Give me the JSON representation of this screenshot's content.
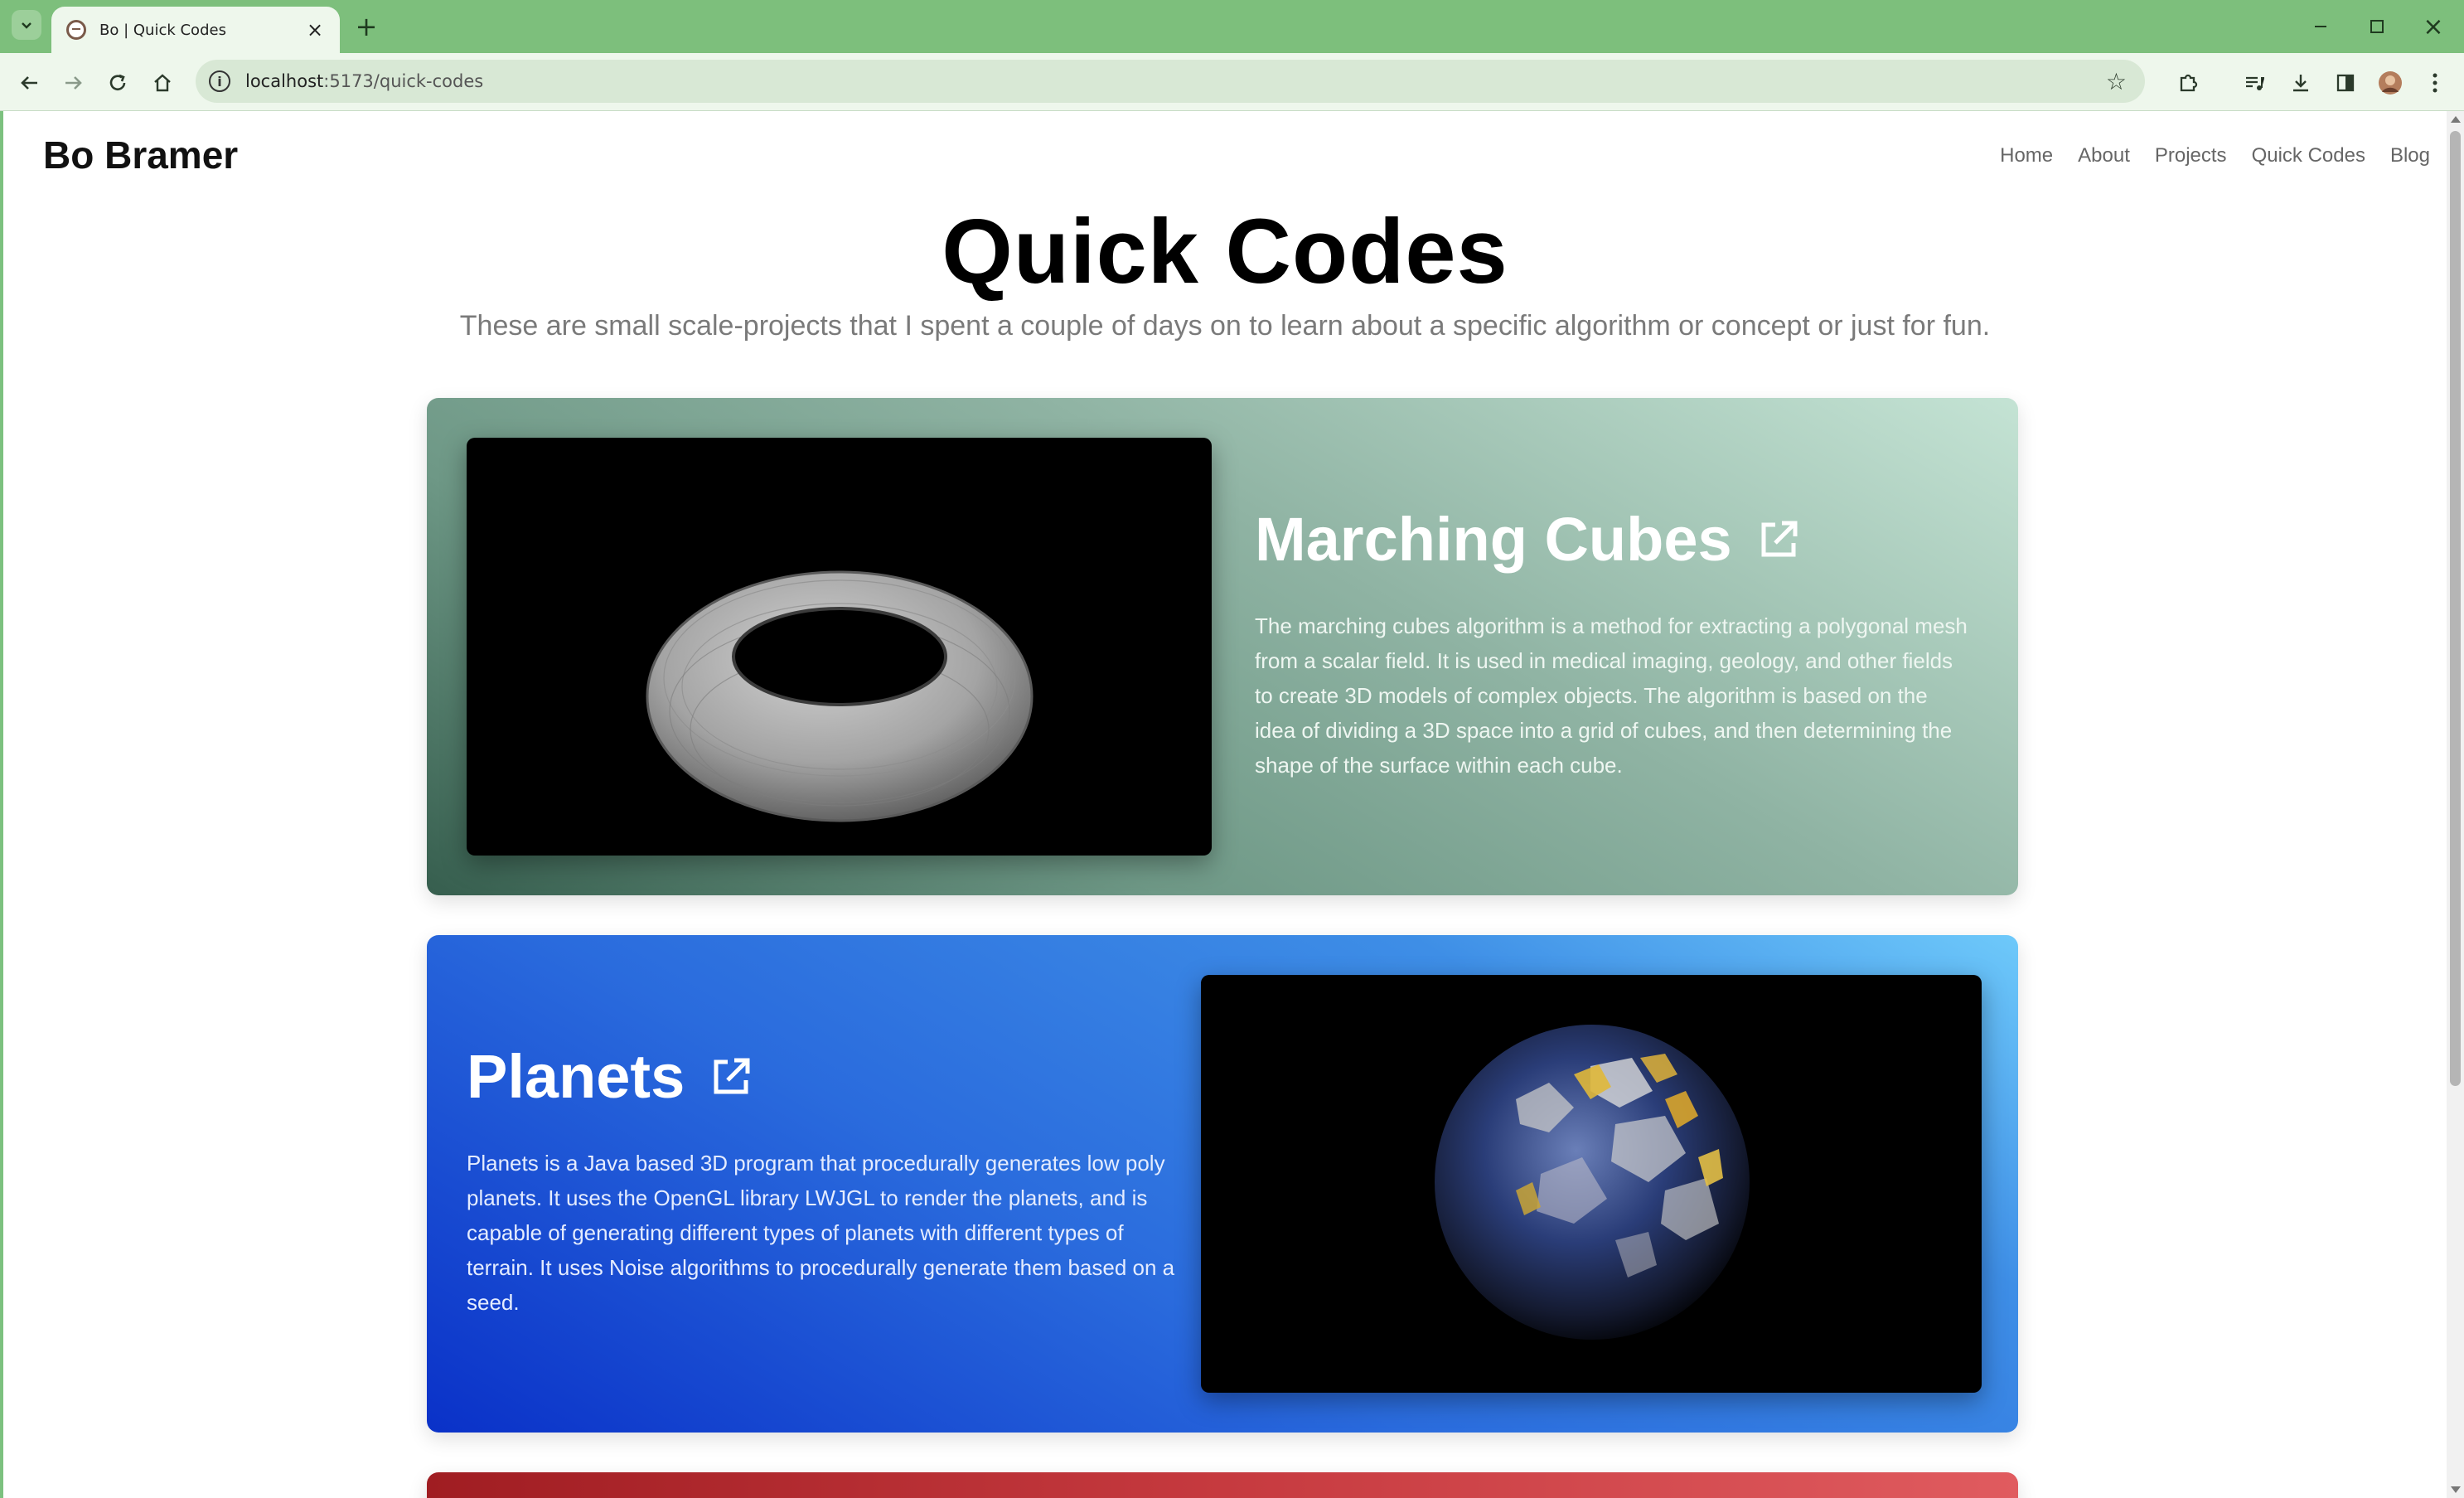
{
  "browser": {
    "tab_title": "Bo | Quick Codes",
    "url_host": "localhost",
    "url_path": ":5173/quick-codes"
  },
  "site": {
    "name": "Bo Bramer",
    "nav": [
      "Home",
      "About",
      "Projects",
      "Quick Codes",
      "Blog"
    ]
  },
  "hero": {
    "title": "Quick Codes",
    "subtitle": "These are small scale-projects that I spent a couple of days on to learn about a specific algorithm or concept or just for fun."
  },
  "projects": [
    {
      "title": "Marching Cubes",
      "description": "The marching cubes algorithm is a method for extracting a polygonal mesh from a scalar field. It is used in medical imaging, geology, and other fields to create 3D models of complex objects. The algorithm is based on the idea of dividing a 3D space into a grid of cubes, and then determining the shape of the surface within each cube.",
      "icon": "external-link-icon"
    },
    {
      "title": "Planets",
      "description": "Planets is a Java based 3D program that procedurally generates low poly planets. It uses the OpenGL library LWJGL to render the planets, and is capable of generating different types of planets with different types of terrain. It uses Noise algorithms to procedurally generate them based on a seed.",
      "icon": "external-link-icon"
    }
  ],
  "colors": {
    "browser_frame": "#7dbf7c",
    "card_1_accent": "#8fb3a3",
    "card_2_accent": "#2a6bdd",
    "card_3_accent": "#c63a3f"
  }
}
